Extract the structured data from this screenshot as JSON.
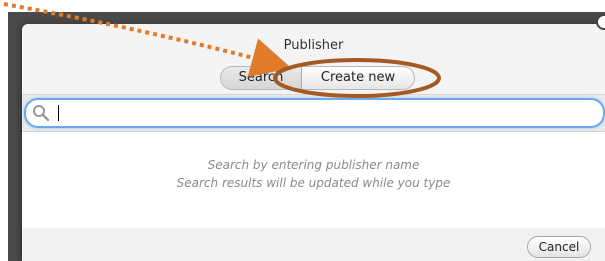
{
  "dialog": {
    "title": "Publisher",
    "tabs": [
      {
        "label": "Search",
        "selected": true
      },
      {
        "label": "Create new",
        "selected": false
      }
    ],
    "search": {
      "value": "",
      "placeholder": ""
    },
    "hints": [
      "Search by entering publisher name",
      "Search results will be updated while you type"
    ],
    "cancel_label": "Cancel"
  },
  "colors": {
    "annotation_orange": "#e07b2a",
    "annotation_circle": "#a45a23",
    "focus_ring": "#6aa9f0"
  },
  "icons": [
    "search-icon",
    "close-icon"
  ]
}
